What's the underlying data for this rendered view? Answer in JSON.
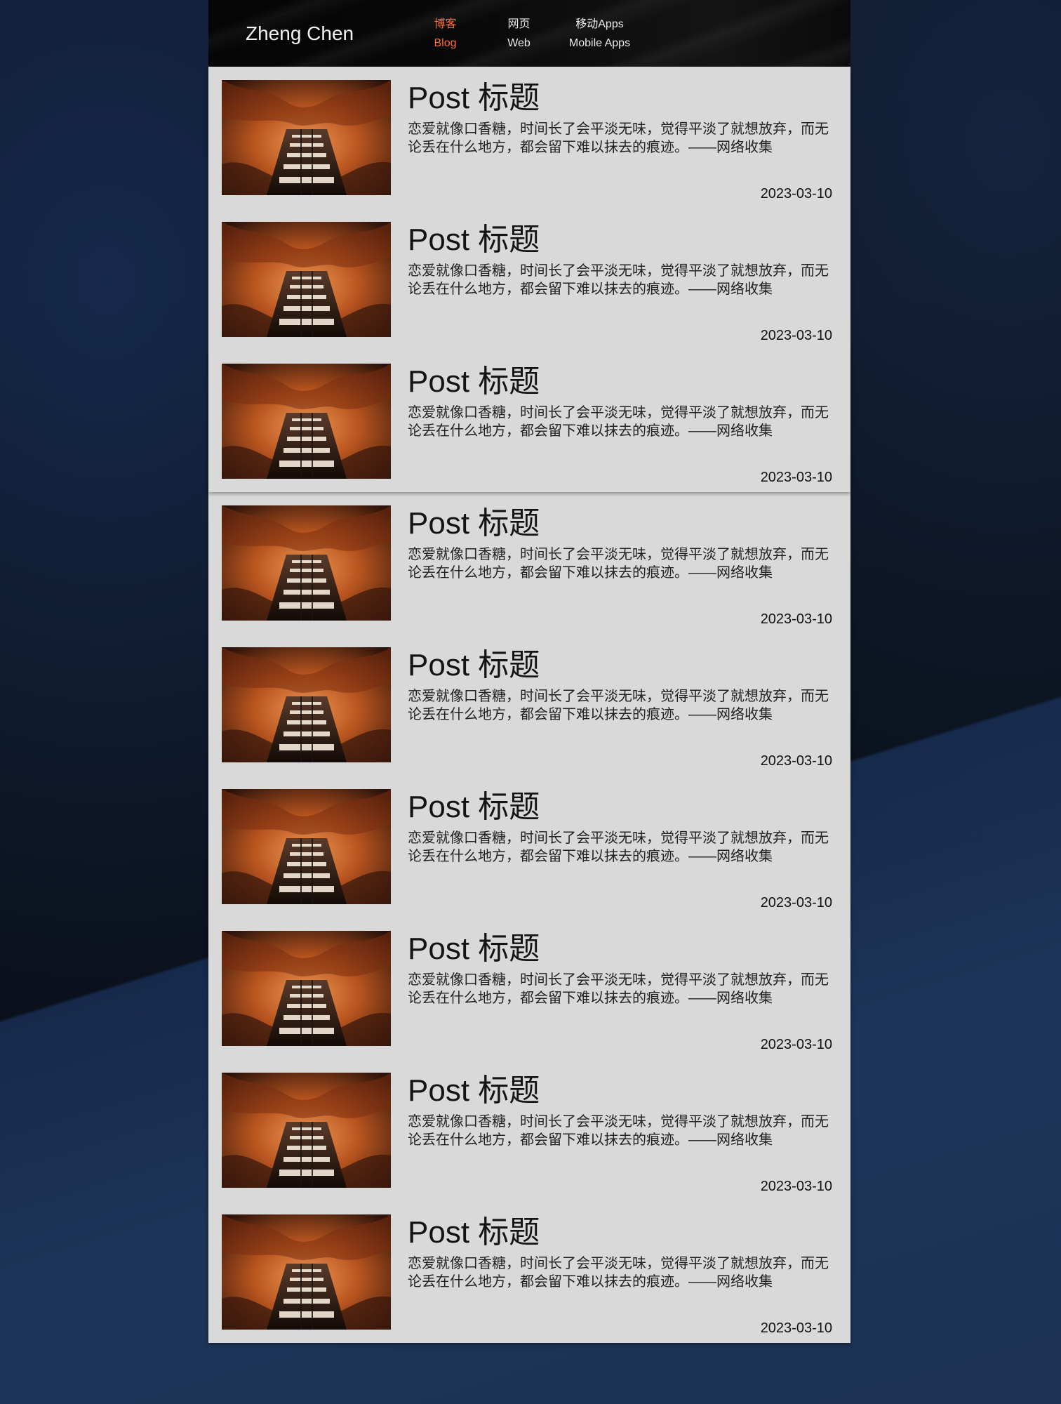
{
  "header": {
    "brand": "Zheng Chen",
    "nav": [
      {
        "cn": "博客",
        "en": "Blog",
        "active": true
      },
      {
        "cn": "网页",
        "en": "Web",
        "active": false
      },
      {
        "cn": "移动Apps",
        "en": "Mobile  Apps",
        "active": false
      }
    ],
    "accent_color": "#ff6b35"
  },
  "posts": [
    {
      "title": "Post 标题",
      "excerpt": "恋爱就像口香糖，时间长了会平淡无味，觉得平淡了就想放弃，而无论丢在什么地方，都会留下难以抹去的痕迹。——网络收集",
      "date": "2023-03-10"
    },
    {
      "title": "Post 标题",
      "excerpt": "恋爱就像口香糖，时间长了会平淡无味，觉得平淡了就想放弃，而无论丢在什么地方，都会留下难以抹去的痕迹。——网络收集",
      "date": "2023-03-10"
    },
    {
      "title": "Post 标题",
      "excerpt": "恋爱就像口香糖，时间长了会平淡无味，觉得平淡了就想放弃，而无论丢在什么地方，都会留下难以抹去的痕迹。——网络收集",
      "date": "2023-03-10"
    },
    {
      "title": "Post 标题",
      "excerpt": "恋爱就像口香糖，时间长了会平淡无味，觉得平淡了就想放弃，而无论丢在什么地方，都会留下难以抹去的痕迹。——网络收集",
      "date": "2023-03-10"
    },
    {
      "title": "Post 标题",
      "excerpt": "恋爱就像口香糖，时间长了会平淡无味，觉得平淡了就想放弃，而无论丢在什么地方，都会留下难以抹去的痕迹。——网络收集",
      "date": "2023-03-10"
    },
    {
      "title": "Post 标题",
      "excerpt": "恋爱就像口香糖，时间长了会平淡无味，觉得平淡了就想放弃，而无论丢在什么地方，都会留下难以抹去的痕迹。——网络收集",
      "date": "2023-03-10"
    },
    {
      "title": "Post 标题",
      "excerpt": "恋爱就像口香糖，时间长了会平淡无味，觉得平淡了就想放弃，而无论丢在什么地方，都会留下难以抹去的痕迹。——网络收集",
      "date": "2023-03-10"
    },
    {
      "title": "Post 标题",
      "excerpt": "恋爱就像口香糖，时间长了会平淡无味，觉得平淡了就想放弃，而无论丢在什么地方，都会留下难以抹去的痕迹。——网络收集",
      "date": "2023-03-10"
    },
    {
      "title": "Post 标题",
      "excerpt": "恋爱就像口香糖，时间长了会平淡无味，觉得平淡了就想放弃，而无论丢在什么地方，都会留下难以抹去的痕迹。——网络收集",
      "date": "2023-03-10"
    }
  ]
}
